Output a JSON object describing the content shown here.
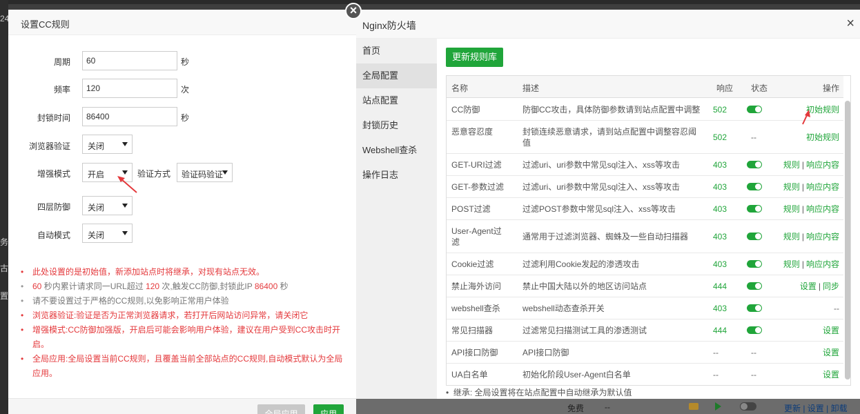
{
  "background": {
    "side_chars": [
      "24",
      "务",
      "古",
      "置"
    ],
    "bottom_bar": {
      "free": "免费",
      "dashes": "--",
      "links": "更新 | 设置 | 卸载"
    }
  },
  "dialog": {
    "title": "设置CC规则",
    "fields": {
      "period": {
        "label": "周期",
        "value": "60",
        "unit": "秒"
      },
      "frequency": {
        "label": "频率",
        "value": "120",
        "unit": "次"
      },
      "block_time": {
        "label": "封锁时间",
        "value": "86400",
        "unit": "秒"
      },
      "browser_verify": {
        "label": "浏览器验证",
        "value": "关闭"
      },
      "enhanced_mode": {
        "label": "增强模式",
        "value": "开启"
      },
      "verify_method": {
        "label": "验证方式",
        "value": "验证码验证"
      },
      "layer4": {
        "label": "四层防御",
        "value": "关闭"
      },
      "auto_mode": {
        "label": "自动模式",
        "value": "关闭"
      }
    },
    "notes": {
      "n1": "此处设置的是初始值，新添加站点时将继承，对现有站点无效。",
      "n2_a": "60",
      "n2_b": " 秒内累计请求同一URL超过 ",
      "n2_c": "120",
      "n2_d": " 次,触发CC防御,封锁此IP ",
      "n2_e": "86400",
      "n2_f": " 秒",
      "n3": "请不要设置过于严格的CC规则,以免影响正常用户体验",
      "n4": "浏览器验证:验证是否为正常浏览器请求，若打开后网站访问异常，请关闭它",
      "n5": "增强模式:CC防御加强版，开启后可能会影响用户体验，建议在用户受到CC攻击时开启。",
      "n6": "全局应用:全局设置当前CC规则，且覆盖当前全部站点的CC规则,自动模式默认为全局应用。"
    },
    "buttons": {
      "global_apply": "全局应用",
      "apply": "应用"
    }
  },
  "firewall": {
    "title": "Nginx防火墙",
    "nav": [
      "首页",
      "全局配置",
      "站点配置",
      "封锁历史",
      "Webshell查杀",
      "操作日志"
    ],
    "update_button": "更新规则库",
    "columns": {
      "name": "名称",
      "desc": "描述",
      "resp": "响应",
      "status": "状态",
      "ops": "操作"
    },
    "rows": [
      {
        "name": "CC防御",
        "desc": "防御CC攻击，具体防御参数请到站点配置中调整",
        "resp": "502",
        "status": "on",
        "ops": [
          "初始规则"
        ]
      },
      {
        "name": "恶意容忍度",
        "desc": "封锁连续恶意请求，请到站点配置中调整容忍阈值",
        "resp": "502",
        "status": "--",
        "ops": [
          "初始规则"
        ]
      },
      {
        "name": "GET-URI过滤",
        "desc": "过滤uri、uri参数中常见sql注入、xss等攻击",
        "resp": "403",
        "status": "on",
        "ops": [
          "规则",
          "响应内容"
        ]
      },
      {
        "name": "GET-参数过滤",
        "desc": "过滤uri、uri参数中常见sql注入、xss等攻击",
        "resp": "403",
        "status": "on",
        "ops": [
          "规则",
          "响应内容"
        ]
      },
      {
        "name": "POST过滤",
        "desc": "过滤POST参数中常见sql注入、xss等攻击",
        "resp": "403",
        "status": "on",
        "ops": [
          "规则",
          "响应内容"
        ]
      },
      {
        "name": "User-Agent过滤",
        "desc": "通常用于过滤浏览器、蜘蛛及一些自动扫描器",
        "resp": "403",
        "status": "on",
        "ops": [
          "规则",
          "响应内容"
        ]
      },
      {
        "name": "Cookie过滤",
        "desc": "过滤利用Cookie发起的渗透攻击",
        "resp": "403",
        "status": "on",
        "ops": [
          "规则",
          "响应内容"
        ]
      },
      {
        "name": "禁止海外访问",
        "desc": "禁止中国大陆以外的地区访问站点",
        "resp": "444",
        "status": "on",
        "ops": [
          "设置",
          "同步"
        ]
      },
      {
        "name": "webshell查杀",
        "desc": "webshell动态查杀开关",
        "resp": "403",
        "status": "on",
        "ops": [
          "--"
        ]
      },
      {
        "name": "常见扫描器",
        "desc": "过滤常见扫描测试工具的渗透测试",
        "resp": "444",
        "status": "on",
        "ops": [
          "设置"
        ]
      },
      {
        "name": "API接口防御",
        "desc": "API接口防御",
        "resp": "--",
        "status": "--",
        "ops": [
          "设置"
        ]
      },
      {
        "name": "UA白名单",
        "desc": "初始化阶段User-Agent白名单",
        "resp": "--",
        "status": "--",
        "ops": [
          "设置"
        ]
      }
    ],
    "footnote": "继承: 全局设置将在站点配置中自动继承为默认值"
  },
  "colors": {
    "accent": "#20a53a",
    "warning": "#e4393c"
  }
}
